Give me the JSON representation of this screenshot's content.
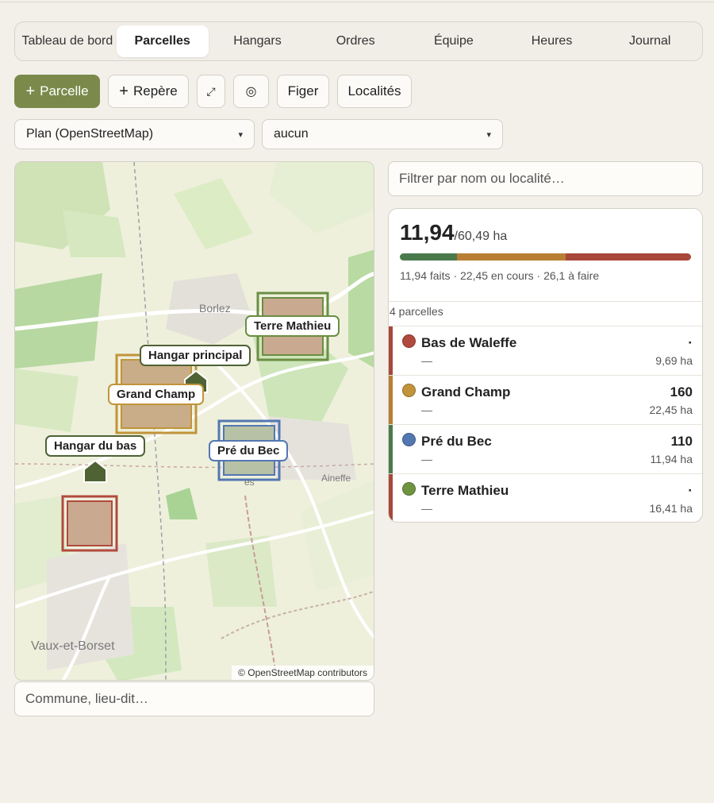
{
  "tabs": [
    {
      "label": "Tableau de bord",
      "active": false
    },
    {
      "label": "Parcelles",
      "active": true
    },
    {
      "label": "Hangars",
      "active": false
    },
    {
      "label": "Ordres",
      "active": false
    },
    {
      "label": "Équipe",
      "active": false
    },
    {
      "label": "Heures",
      "active": false
    },
    {
      "label": "Journal",
      "active": false
    }
  ],
  "toolbar": {
    "add_parcel": "Parcelle",
    "add_marker": "Repère",
    "fit_icon": "⤢",
    "locate_icon": "◎",
    "freeze": "Figer",
    "localities": "Localités"
  },
  "selects": {
    "basemap": "Plan (OpenStreetMap)",
    "overlay": "aucun"
  },
  "map": {
    "places": [
      "Borlez",
      "Aineffe",
      "Vaux-et-Borset",
      "es"
    ],
    "parcel_labels": {
      "terre_mathieu": "Terre Mathieu",
      "grand_champ": "Grand Champ",
      "pre_du_bec": "Pré du Bec"
    },
    "shed_labels": {
      "principal": "Hangar principal",
      "bas": "Hangar du bas"
    },
    "attribution": "© OpenStreetMap contributors"
  },
  "place_search": {
    "placeholder": "Commune, lieu-dit…"
  },
  "filter": {
    "placeholder": "Filtrer par nom ou localité…"
  },
  "summary": {
    "done": "11,94",
    "total": "/60,49 ha",
    "legend": "11,94 faits · 22,45 en cours · 26,1 à faire",
    "progress": {
      "done": 11.94,
      "in_progress": 22.45,
      "todo": 26.1
    },
    "colors": {
      "done": "#4a7a4c",
      "in_progress": "#b87f34",
      "todo": "#a8473a"
    }
  },
  "parcel_count": "4 parcelles",
  "parcels": [
    {
      "name": "Bas de Waleffe",
      "sub": "—",
      "code": "·",
      "area": "9,69 ha",
      "dot": "#b14a3e",
      "bar": "#a8473a"
    },
    {
      "name": "Grand Champ",
      "sub": "—",
      "code": "160",
      "area": "22,45 ha",
      "dot": "#c1943a",
      "bar": "#b87f34"
    },
    {
      "name": "Pré du Bec",
      "sub": "—",
      "code": "110",
      "area": "11,94 ha",
      "dot": "#5377b2",
      "bar": "#4a7a4c"
    },
    {
      "name": "Terre Mathieu",
      "sub": "—",
      "code": "·",
      "area": "16,41 ha",
      "dot": "#6e9440",
      "bar": "#a8473a"
    }
  ]
}
